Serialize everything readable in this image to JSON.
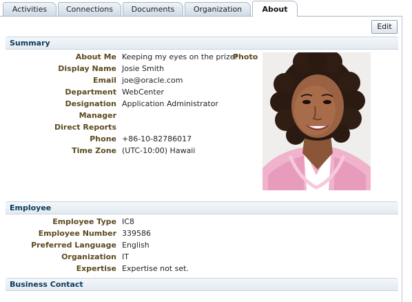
{
  "tabs": [
    {
      "label": "Activities",
      "active": false
    },
    {
      "label": "Connections",
      "active": false
    },
    {
      "label": "Documents",
      "active": false
    },
    {
      "label": "Organization",
      "active": false
    },
    {
      "label": "About",
      "active": true
    }
  ],
  "toolbar": {
    "edit_label": "Edit"
  },
  "summary": {
    "title": "Summary",
    "photo_label": "Photo",
    "fields": [
      {
        "label": "About Me",
        "value": "Keeping my eyes on the prize!"
      },
      {
        "label": "Display Name",
        "value": "Josie Smith"
      },
      {
        "label": "Email",
        "value": "joe@oracle.com"
      },
      {
        "label": "Department",
        "value": "WebCenter"
      },
      {
        "label": "Designation",
        "value": "Application Administrator"
      },
      {
        "label": "Manager",
        "value": ""
      },
      {
        "label": "Direct Reports",
        "value": ""
      },
      {
        "label": "Phone",
        "value": "+86-10-82786017"
      },
      {
        "label": "Time Zone",
        "value": "(UTC-10:00) Hawaii"
      }
    ]
  },
  "employee": {
    "title": "Employee",
    "fields": [
      {
        "label": "Employee Type",
        "value": "IC8"
      },
      {
        "label": "Employee Number",
        "value": "339586"
      },
      {
        "label": "Preferred Language",
        "value": "English"
      },
      {
        "label": "Organization",
        "value": "IT"
      },
      {
        "label": "Expertise",
        "value": "Expertise not set."
      }
    ]
  },
  "business_contact": {
    "title": "Business Contact"
  },
  "colors": {
    "section_title": "#0b3a5b",
    "field_label": "#5a4a1f",
    "tab_border": "#aab6c4"
  }
}
